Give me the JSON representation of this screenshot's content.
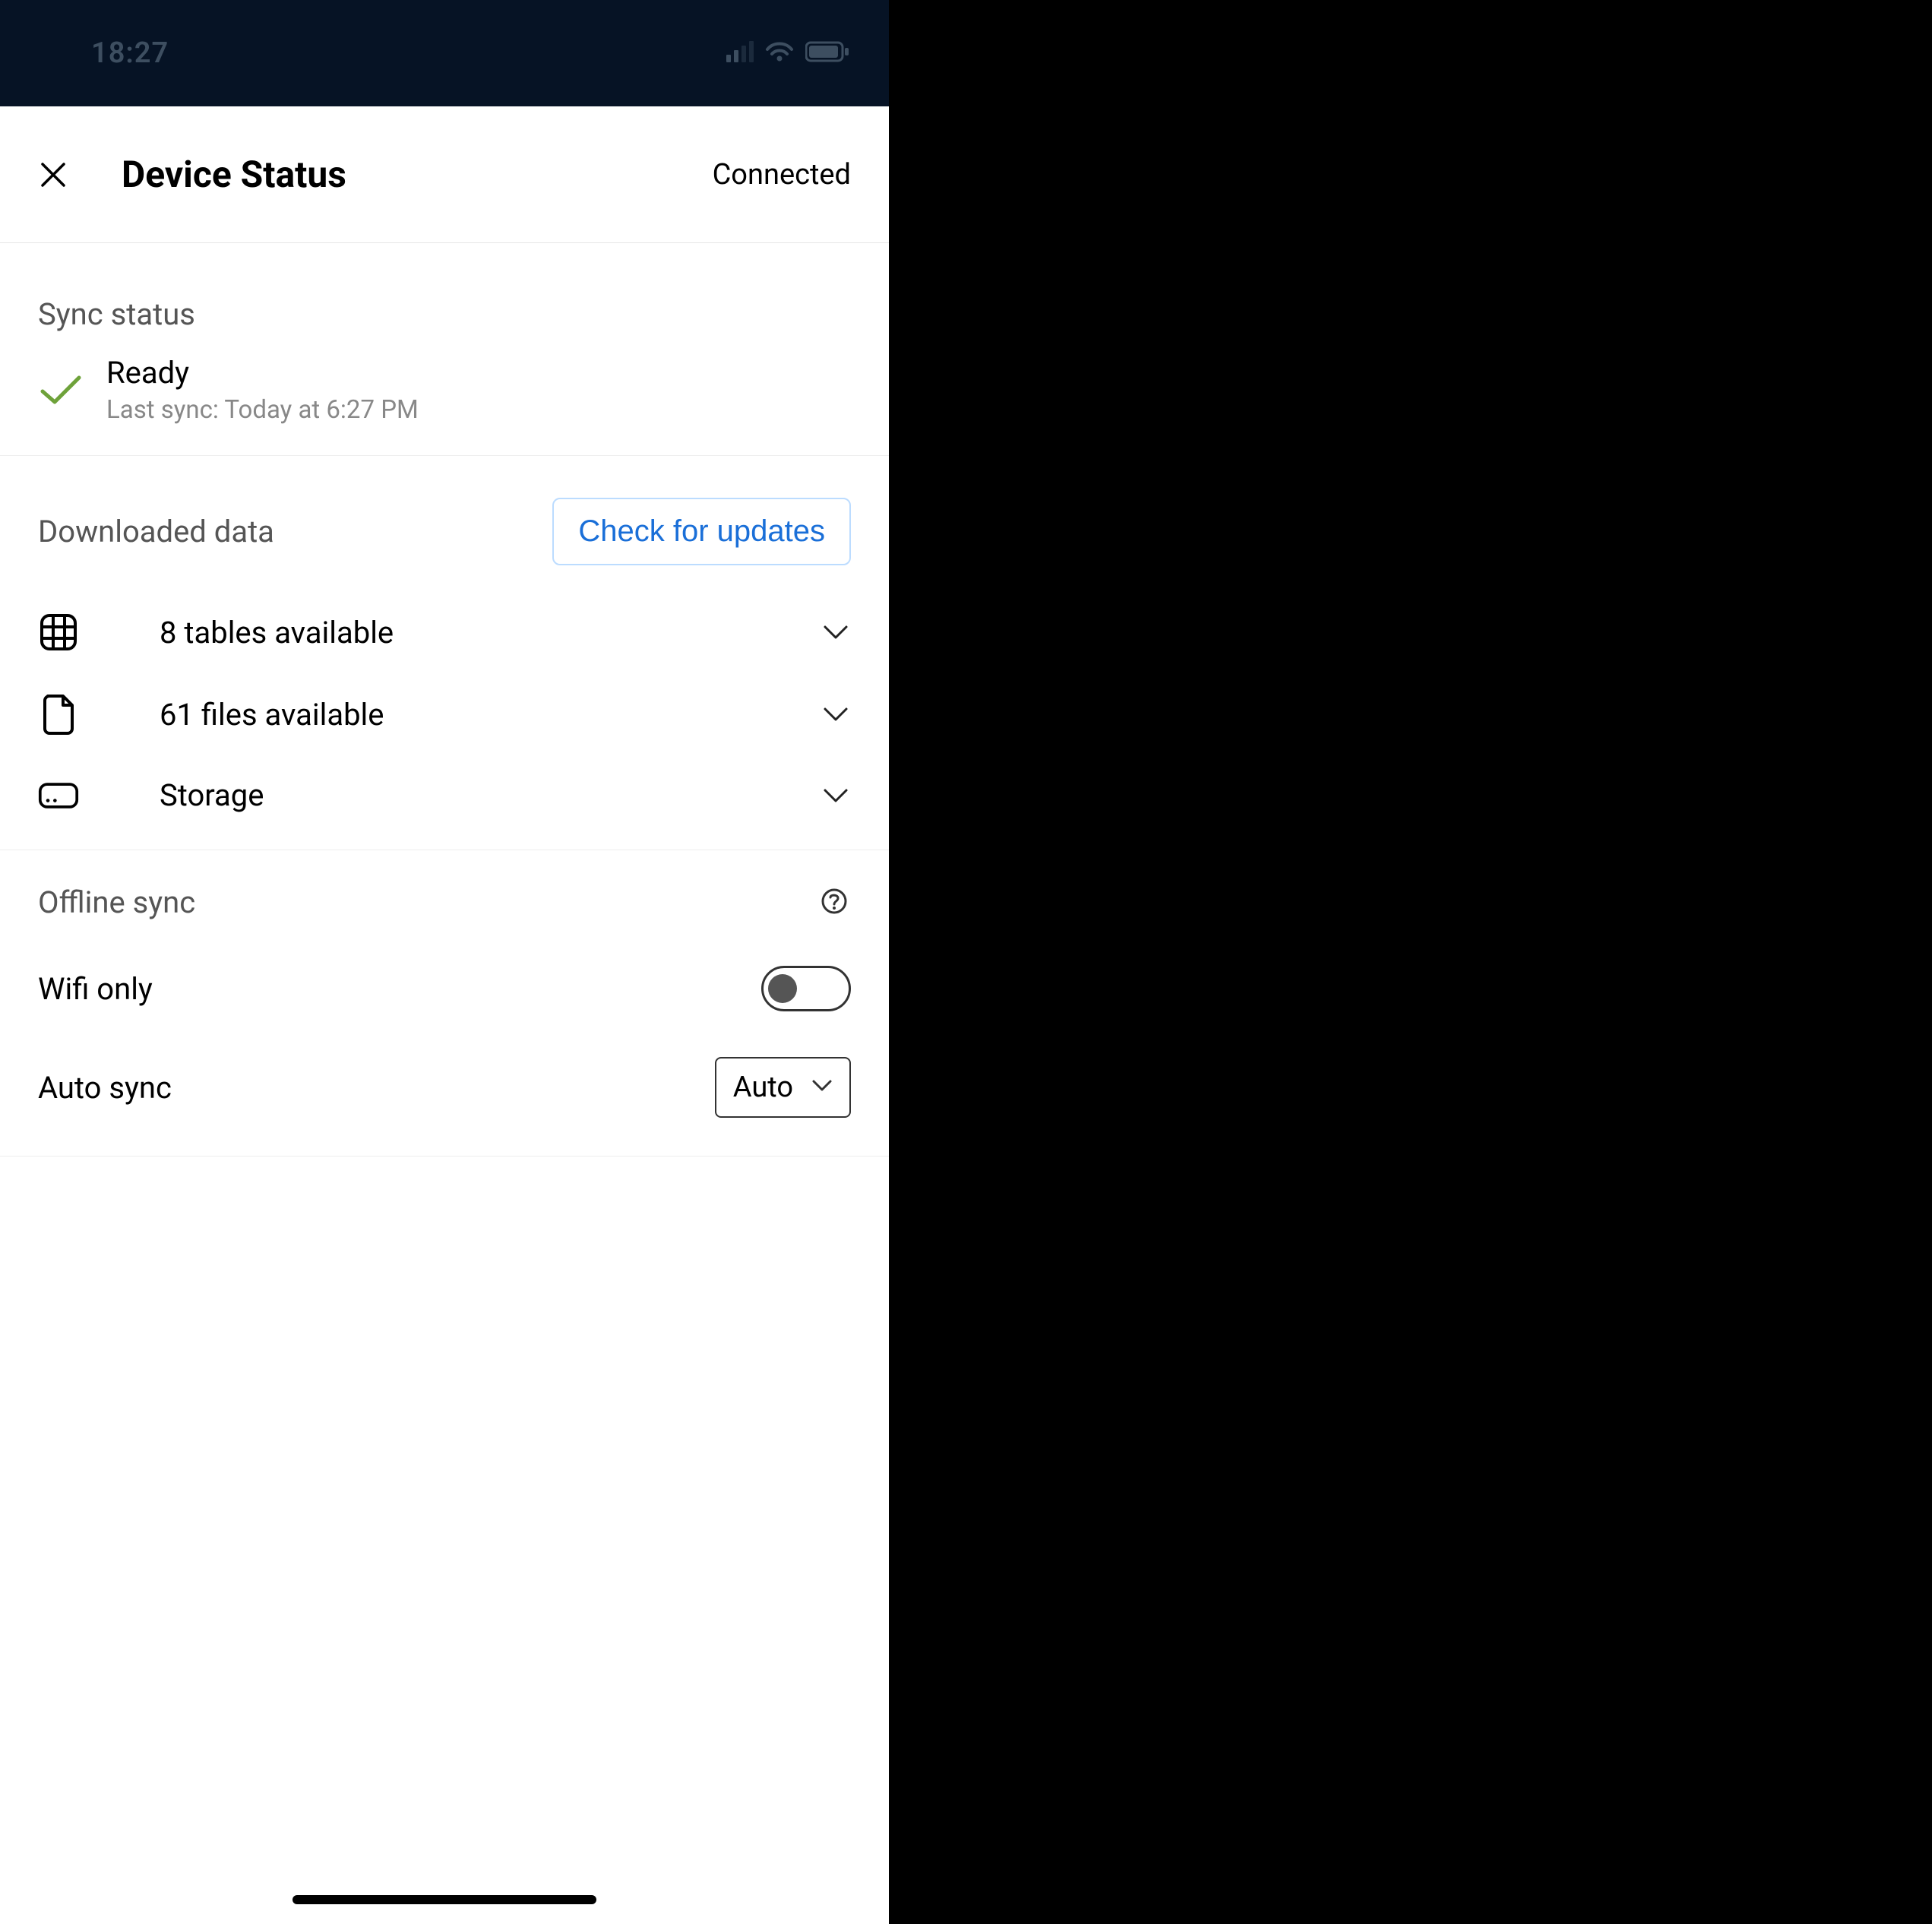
{
  "status_bar": {
    "time": "18:27"
  },
  "header": {
    "title": "Device Status",
    "connection": "Connected"
  },
  "sync": {
    "section_label": "Sync status",
    "state": "Ready",
    "last_sync": "Last sync: Today at 6:27 PM"
  },
  "downloaded": {
    "section_label": "Downloaded data",
    "check_button": "Check for updates",
    "rows": [
      {
        "icon": "grid-icon",
        "label": "8 tables available"
      },
      {
        "icon": "file-icon",
        "label": "61 files available"
      },
      {
        "icon": "storage-icon",
        "label": "Storage"
      }
    ]
  },
  "offline": {
    "section_label": "Offline sync",
    "wifi_only_label": "Wifi only",
    "wifi_only_value": false,
    "auto_sync_label": "Auto sync",
    "auto_sync_value": "Auto"
  }
}
